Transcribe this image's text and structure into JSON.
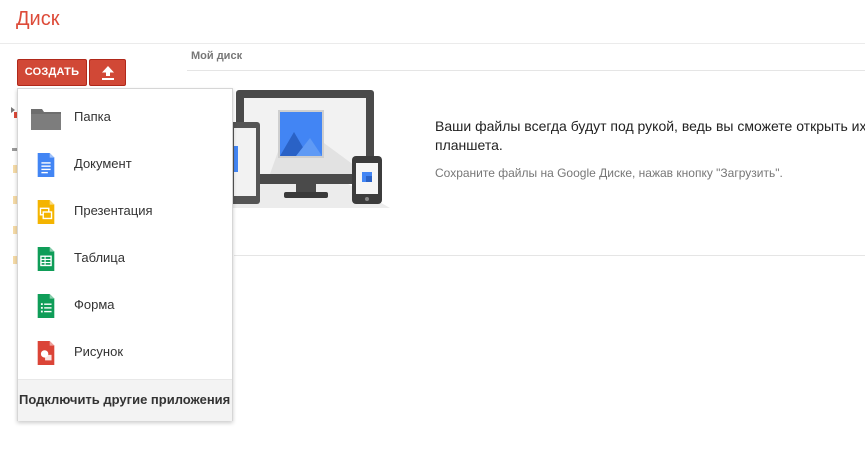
{
  "header": {
    "title": "Диск"
  },
  "toolbar": {
    "create_label": "СОЗДАТЬ",
    "upload_icon": "upload-icon"
  },
  "breadcrumb": {
    "label": "Мой диск"
  },
  "welcome": {
    "main_text": "Ваши файлы всегда будут под рукой, ведь вы сможете открыть их на компьютере, телефоне или планшета.",
    "line1": "Ваши файлы всегда будут под рукой, ведь вы сможете открыть их на компьютере, телефоне или",
    "line2": "планшета.",
    "sub_text": "Сохраните файлы на Google Диске, нажав кнопку \"Загрузить\"."
  },
  "create_menu": {
    "items": [
      {
        "label": "Папка",
        "icon": "folder-icon"
      },
      {
        "label": "Документ",
        "icon": "document-icon"
      },
      {
        "label": "Презентация",
        "icon": "presentation-icon"
      },
      {
        "label": "Таблица",
        "icon": "spreadsheet-icon"
      },
      {
        "label": "Форма",
        "icon": "form-icon"
      },
      {
        "label": "Рисунок",
        "icon": "drawing-icon"
      }
    ],
    "footer_label": "Подключить другие приложения"
  },
  "colors": {
    "brand_red": "#dd4b39",
    "button_red": "#d14836",
    "doc_blue": "#4285f4",
    "slides_yellow": "#f4b400",
    "sheets_green": "#0f9d58",
    "drawing_red": "#db4437"
  }
}
